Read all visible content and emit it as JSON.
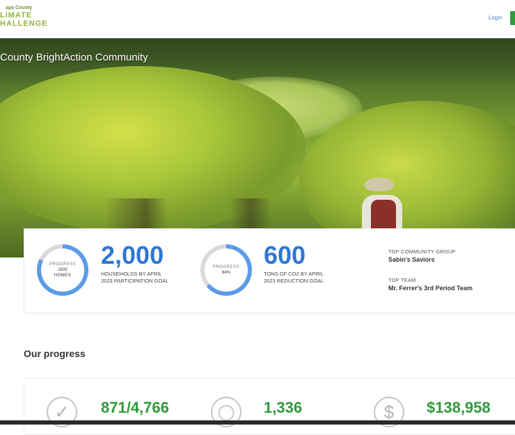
{
  "header": {
    "logo_line1": "apa County",
    "logo_line2": "LIMATE",
    "logo_line3": "HALLENGE",
    "login_label": "Login"
  },
  "hero": {
    "title": "County BrightAction Community"
  },
  "stats": {
    "households": {
      "ring_label": "PROGRESS",
      "ring_value": "1635",
      "ring_unit": "HOMES",
      "progress_fraction": 0.82,
      "goal": "2,000",
      "caption_line1": "HOUSEHOLDS BY APRIL",
      "caption_line2": "2023 PARTICIPATION GOAL"
    },
    "co2": {
      "ring_label": "PROGRESS",
      "ring_value": "64%",
      "progress_fraction": 0.64,
      "goal": "600",
      "caption_line1": "TONS OF CO2 BY APRIL",
      "caption_line2": "2023 REDUCTION GOAL"
    },
    "top_group_label": "TOP COMMUNITY GROUP",
    "top_group_value": "Sabin's Saviors",
    "top_team_label": "TOP TEAM",
    "top_team_value": "Mr. Ferrer's 3rd Period Team"
  },
  "progress_section": {
    "title": "Our progress",
    "items": [
      {
        "icon": "check-icon",
        "value": "871/4,766"
      },
      {
        "icon": "lightbulb-icon",
        "value": "1,336"
      },
      {
        "icon": "dollar-icon",
        "value": "$138,958"
      }
    ]
  },
  "colors": {
    "ring_fill": "#5b9be8",
    "ring_track": "#d9d9d9",
    "accent_blue": "#2f76d4",
    "accent_green": "#2e9a3a"
  }
}
